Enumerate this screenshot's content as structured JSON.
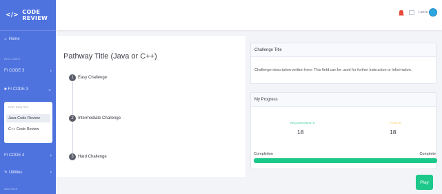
{
  "brand": {
    "name": "CODE REVIEW",
    "icon": "code-icon"
  },
  "sidebar": {
    "home": {
      "label": "Home",
      "icon": "home-icon"
    },
    "section_heading": "INCLUDES",
    "items": [
      {
        "label": "FI CODE 3"
      },
      {
        "label": "FI CODE 3"
      }
    ],
    "collapse": {
      "heading": "FOR ROUTES",
      "items": [
        "Java Code Review",
        "C++ Code Review"
      ]
    },
    "lower_items": [
      {
        "label": "FI CODE 4"
      },
      {
        "label": "Utilities",
        "icon": "wrench-icon"
      }
    ],
    "bottom_heading": "ADDONS"
  },
  "topbar": {
    "username": "Lance",
    "alert_count": ""
  },
  "pathway": {
    "title": "Pathway Title (Java or C++)",
    "steps": [
      {
        "number": "1",
        "label": "Easy Challenge"
      },
      {
        "number": "2",
        "label": "Intermediate Challenge"
      },
      {
        "number": "3",
        "label": "Hard Challenge"
      }
    ]
  },
  "challenge": {
    "title": "Challenge Title",
    "description": "Challenge description written here. This field can be used for further instruction or information."
  },
  "progress": {
    "title": "My Progress",
    "requirements_label": "REQUIREMENTS",
    "requirements_value": "18",
    "points_label": "POINTS",
    "points_value": "18",
    "completion_label": "Completion",
    "complete_label": "Complete",
    "completion_fraction": 1.0
  },
  "play_label": "Play",
  "colors": {
    "sidebar": "#4e73df",
    "success": "#1cc88a",
    "danger": "#e74a3b"
  }
}
